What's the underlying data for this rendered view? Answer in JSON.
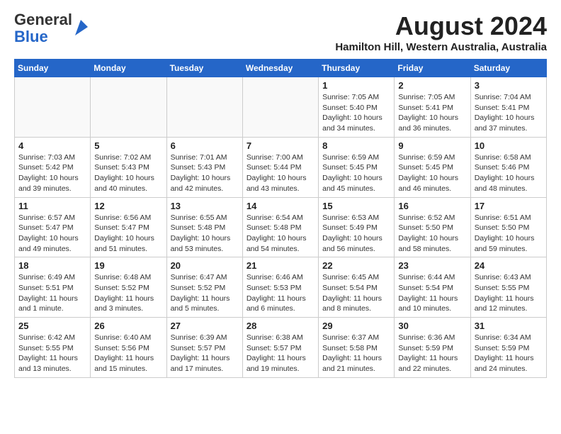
{
  "header": {
    "logo_general": "General",
    "logo_blue": "Blue",
    "title": "August 2024",
    "subtitle": "Hamilton Hill, Western Australia, Australia"
  },
  "days_of_week": [
    "Sunday",
    "Monday",
    "Tuesday",
    "Wednesday",
    "Thursday",
    "Friday",
    "Saturday"
  ],
  "weeks": [
    [
      {
        "day": "",
        "detail": ""
      },
      {
        "day": "",
        "detail": ""
      },
      {
        "day": "",
        "detail": ""
      },
      {
        "day": "",
        "detail": ""
      },
      {
        "day": "1",
        "detail": "Sunrise: 7:05 AM\nSunset: 5:40 PM\nDaylight: 10 hours\nand 34 minutes."
      },
      {
        "day": "2",
        "detail": "Sunrise: 7:05 AM\nSunset: 5:41 PM\nDaylight: 10 hours\nand 36 minutes."
      },
      {
        "day": "3",
        "detail": "Sunrise: 7:04 AM\nSunset: 5:41 PM\nDaylight: 10 hours\nand 37 minutes."
      }
    ],
    [
      {
        "day": "4",
        "detail": "Sunrise: 7:03 AM\nSunset: 5:42 PM\nDaylight: 10 hours\nand 39 minutes."
      },
      {
        "day": "5",
        "detail": "Sunrise: 7:02 AM\nSunset: 5:43 PM\nDaylight: 10 hours\nand 40 minutes."
      },
      {
        "day": "6",
        "detail": "Sunrise: 7:01 AM\nSunset: 5:43 PM\nDaylight: 10 hours\nand 42 minutes."
      },
      {
        "day": "7",
        "detail": "Sunrise: 7:00 AM\nSunset: 5:44 PM\nDaylight: 10 hours\nand 43 minutes."
      },
      {
        "day": "8",
        "detail": "Sunrise: 6:59 AM\nSunset: 5:45 PM\nDaylight: 10 hours\nand 45 minutes."
      },
      {
        "day": "9",
        "detail": "Sunrise: 6:59 AM\nSunset: 5:45 PM\nDaylight: 10 hours\nand 46 minutes."
      },
      {
        "day": "10",
        "detail": "Sunrise: 6:58 AM\nSunset: 5:46 PM\nDaylight: 10 hours\nand 48 minutes."
      }
    ],
    [
      {
        "day": "11",
        "detail": "Sunrise: 6:57 AM\nSunset: 5:47 PM\nDaylight: 10 hours\nand 49 minutes."
      },
      {
        "day": "12",
        "detail": "Sunrise: 6:56 AM\nSunset: 5:47 PM\nDaylight: 10 hours\nand 51 minutes."
      },
      {
        "day": "13",
        "detail": "Sunrise: 6:55 AM\nSunset: 5:48 PM\nDaylight: 10 hours\nand 53 minutes."
      },
      {
        "day": "14",
        "detail": "Sunrise: 6:54 AM\nSunset: 5:48 PM\nDaylight: 10 hours\nand 54 minutes."
      },
      {
        "day": "15",
        "detail": "Sunrise: 6:53 AM\nSunset: 5:49 PM\nDaylight: 10 hours\nand 56 minutes."
      },
      {
        "day": "16",
        "detail": "Sunrise: 6:52 AM\nSunset: 5:50 PM\nDaylight: 10 hours\nand 58 minutes."
      },
      {
        "day": "17",
        "detail": "Sunrise: 6:51 AM\nSunset: 5:50 PM\nDaylight: 10 hours\nand 59 minutes."
      }
    ],
    [
      {
        "day": "18",
        "detail": "Sunrise: 6:49 AM\nSunset: 5:51 PM\nDaylight: 11 hours\nand 1 minute."
      },
      {
        "day": "19",
        "detail": "Sunrise: 6:48 AM\nSunset: 5:52 PM\nDaylight: 11 hours\nand 3 minutes."
      },
      {
        "day": "20",
        "detail": "Sunrise: 6:47 AM\nSunset: 5:52 PM\nDaylight: 11 hours\nand 5 minutes."
      },
      {
        "day": "21",
        "detail": "Sunrise: 6:46 AM\nSunset: 5:53 PM\nDaylight: 11 hours\nand 6 minutes."
      },
      {
        "day": "22",
        "detail": "Sunrise: 6:45 AM\nSunset: 5:54 PM\nDaylight: 11 hours\nand 8 minutes."
      },
      {
        "day": "23",
        "detail": "Sunrise: 6:44 AM\nSunset: 5:54 PM\nDaylight: 11 hours\nand 10 minutes."
      },
      {
        "day": "24",
        "detail": "Sunrise: 6:43 AM\nSunset: 5:55 PM\nDaylight: 11 hours\nand 12 minutes."
      }
    ],
    [
      {
        "day": "25",
        "detail": "Sunrise: 6:42 AM\nSunset: 5:55 PM\nDaylight: 11 hours\nand 13 minutes."
      },
      {
        "day": "26",
        "detail": "Sunrise: 6:40 AM\nSunset: 5:56 PM\nDaylight: 11 hours\nand 15 minutes."
      },
      {
        "day": "27",
        "detail": "Sunrise: 6:39 AM\nSunset: 5:57 PM\nDaylight: 11 hours\nand 17 minutes."
      },
      {
        "day": "28",
        "detail": "Sunrise: 6:38 AM\nSunset: 5:57 PM\nDaylight: 11 hours\nand 19 minutes."
      },
      {
        "day": "29",
        "detail": "Sunrise: 6:37 AM\nSunset: 5:58 PM\nDaylight: 11 hours\nand 21 minutes."
      },
      {
        "day": "30",
        "detail": "Sunrise: 6:36 AM\nSunset: 5:59 PM\nDaylight: 11 hours\nand 22 minutes."
      },
      {
        "day": "31",
        "detail": "Sunrise: 6:34 AM\nSunset: 5:59 PM\nDaylight: 11 hours\nand 24 minutes."
      }
    ]
  ]
}
